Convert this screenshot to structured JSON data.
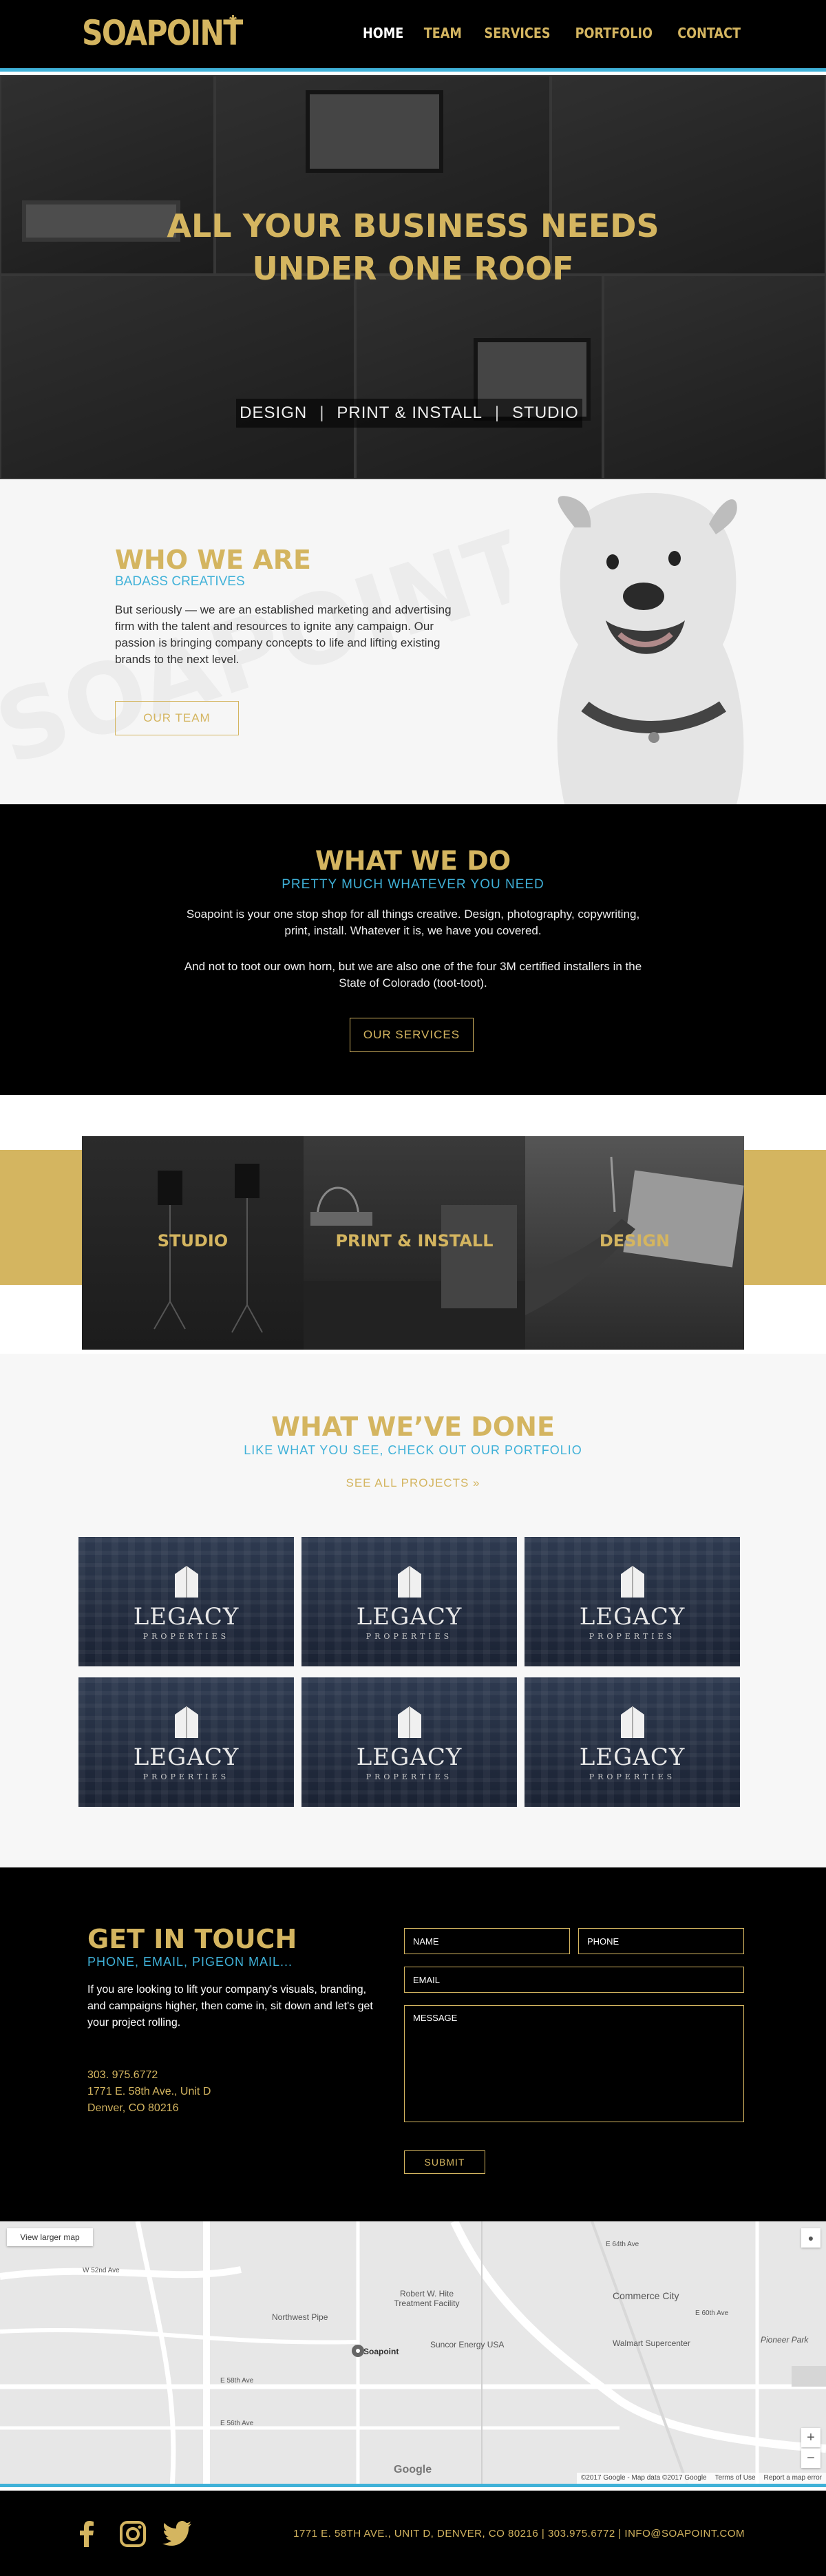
{
  "header": {
    "logo": "SOAPOINT",
    "logo_mark": "*",
    "nav": [
      {
        "label": "HOME",
        "active": true
      },
      {
        "label": "TEAM",
        "active": false
      },
      {
        "label": "SERVICES",
        "active": false
      },
      {
        "label": "PORTFOLIO",
        "active": false
      },
      {
        "label": "CONTACT",
        "active": false
      }
    ]
  },
  "hero": {
    "title_line1": "ALL YOUR BUSINESS NEEDS",
    "title_line2": "UNDER ONE ROOF",
    "tags": [
      "DESIGN",
      "PRINT & INSTALL",
      "STUDIO"
    ],
    "separator": "|"
  },
  "who": {
    "heading": "WHO WE ARE",
    "subheading": "BADASS CREATIVES",
    "body": "But seriously — we are an established marketing and advertising firm with the talent and resources to ignite any campaign. Our passion is bringing company concepts to life and lifting existing brands to the next level.",
    "button": "OUR TEAM"
  },
  "what_we_do": {
    "heading": "WHAT WE DO",
    "subheading": "PRETTY MUCH WHATEVER YOU NEED",
    "p1": "Soapoint is your one stop shop for all things creative. Design, photography, copywriting, print, install. Whatever it is, we have you covered.",
    "p2": "And not to toot our own horn, but we are also one of the four 3M certified installers in the State of Colorado (toot-toot).",
    "button": "OUR SERVICES"
  },
  "services": [
    {
      "label": "STUDIO"
    },
    {
      "label": "PRINT & INSTALL"
    },
    {
      "label": "DESIGN"
    }
  ],
  "done": {
    "heading": "WHAT WE’VE DONE",
    "subheading": "LIKE WHAT YOU SEE, CHECK OUT OUR PORTFOLIO",
    "link": "SEE ALL PROJECTS »",
    "projects": [
      {
        "name": "LEGACY",
        "sub": "PROPERTIES"
      },
      {
        "name": "LEGACY",
        "sub": "PROPERTIES"
      },
      {
        "name": "LEGACY",
        "sub": "PROPERTIES"
      },
      {
        "name": "LEGACY",
        "sub": "PROPERTIES"
      },
      {
        "name": "LEGACY",
        "sub": "PROPERTIES"
      },
      {
        "name": "LEGACY",
        "sub": "PROPERTIES"
      }
    ]
  },
  "touch": {
    "heading": "GET IN TOUCH",
    "subheading": "PHONE, EMAIL, PIGEON MAIL...",
    "body": "If you are looking to lift your company's visuals, branding, and campaigns higher, then come in, sit down and let's get your project rolling.",
    "phone": "303. 975.6772",
    "address1": "1771 E. 58th Ave., Unit D",
    "address2": "Denver, CO 80216",
    "form": {
      "name_ph": "NAME",
      "phone_ph": "PHONE",
      "email_ph": "EMAIL",
      "message_ph": "MESSAGE",
      "submit": "SUBMIT"
    }
  },
  "map": {
    "view_larger": "View larger map",
    "marker_label": "Soapoint",
    "labels": [
      "Northwest Pipe",
      "Robert W. Hite Treatment Facility",
      "Suncor Energy USA",
      "Commerce City",
      "Walmart Supercenter",
      "Pioneer Park",
      "E 58th Ave",
      "E 56th Ave",
      "W 52nd Ave",
      "E 64th Ave",
      "E 60th Ave"
    ],
    "google": "Google",
    "attribution": [
      "©2017 Google - Map data ©2017 Google",
      "Terms of Use",
      "Report a map error"
    ],
    "zoom_in": "+",
    "zoom_out": "−"
  },
  "footer": {
    "info": "1771 E. 58TH AVE., UNIT D, DENVER, CO 80216  |  303.975.6772  |  INFO@SOAPOINT.COM",
    "social": [
      "facebook-icon",
      "instagram-icon",
      "twitter-icon"
    ]
  },
  "colors": {
    "gold": "#d4b560",
    "blue": "#3fb1d8",
    "black": "#000000"
  }
}
